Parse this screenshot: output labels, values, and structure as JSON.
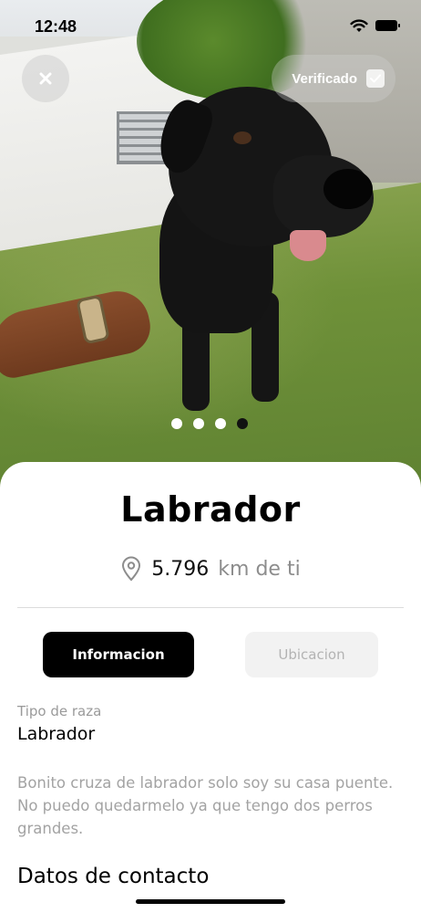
{
  "status_bar": {
    "time": "12:48",
    "icons": [
      "wifi-icon",
      "battery-icon"
    ]
  },
  "photo": {
    "subject": "black labrador dog",
    "verified_label": "Verificado",
    "carousel": {
      "total": 4,
      "active_index": 3
    }
  },
  "pet": {
    "title": "Labrador",
    "distance_value": "5.796",
    "distance_unit": "km de ti"
  },
  "tabs": [
    {
      "label": "Informacion",
      "active": true
    },
    {
      "label": "Ubicacion",
      "active": false
    }
  ],
  "info": {
    "breed_label": "Tipo de raza",
    "breed_value": "Labrador",
    "description": "Bonito cruza de labrador solo soy su casa puente. No puedo quedarmelo ya que tengo dos perros grandes.",
    "contact_heading": "Datos de contacto"
  },
  "colors": {
    "primary": "#000000",
    "muted_text": "#a3a3a3",
    "inactive_tab": "#f2f2f2"
  }
}
